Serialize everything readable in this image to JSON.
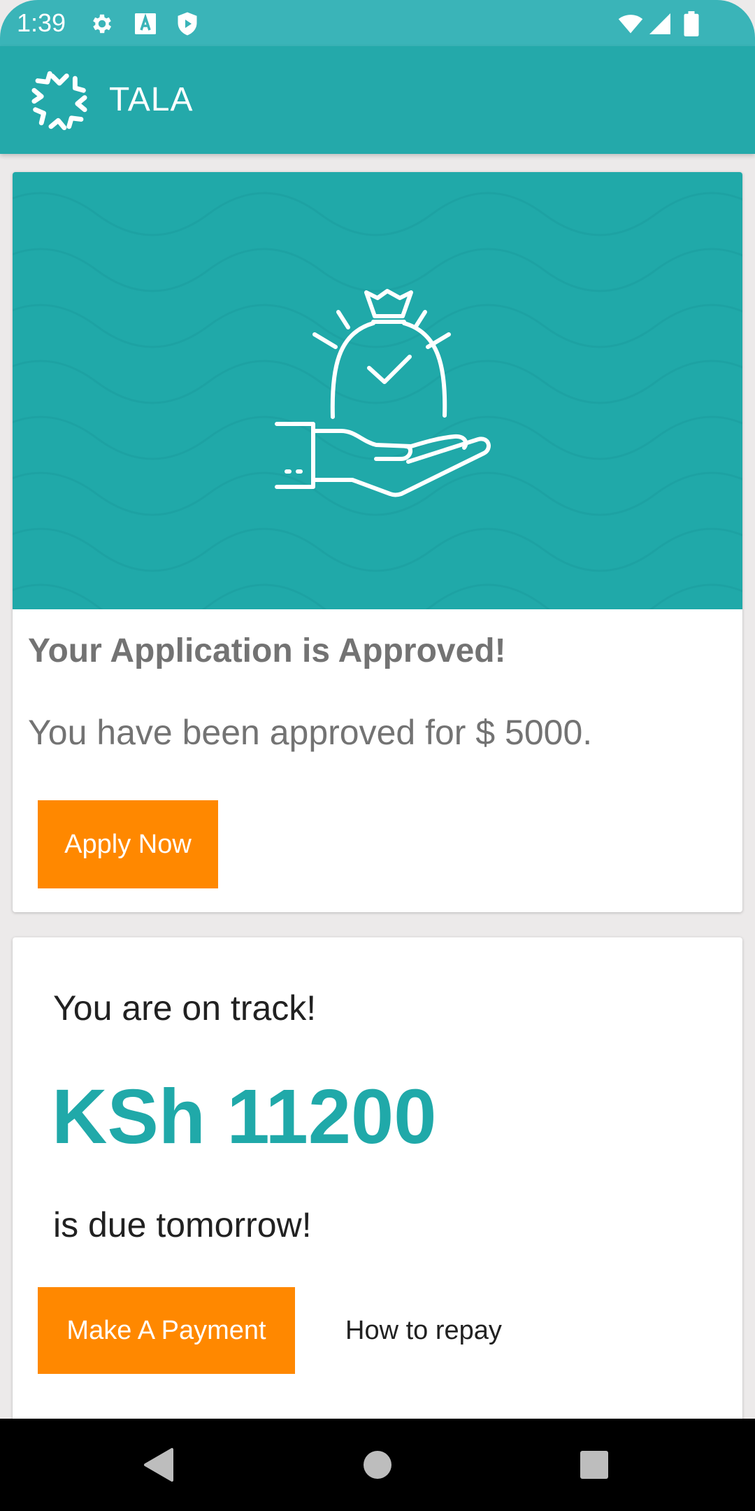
{
  "status_bar": {
    "time": "1:39",
    "icons": [
      "gear-icon",
      "font-a-icon",
      "shield-play-icon",
      "wifi-icon",
      "signal-icon",
      "battery-icon"
    ],
    "background": "#3AB4B8"
  },
  "app_bar": {
    "title": "TALA",
    "logo": "tala-burst-logo",
    "background": "#24A9AA"
  },
  "approved_card": {
    "illustration": "hand-money-bag-check-icon",
    "title": "Your Application is Approved!",
    "message": "You have been approved for $ 5000.",
    "apply_button_label": "Apply Now",
    "hero_color": "#20A9A9"
  },
  "track_card": {
    "heading": "You are on track!",
    "amount": "KSh 11200",
    "due_text": "is due tomorrow!",
    "pay_button_label": "Make A Payment",
    "repay_link_label": "How to repay",
    "amount_color": "#20A9A9"
  },
  "colors": {
    "accent": "#FF8800",
    "teal": "#20A9A9",
    "page_background": "#ECEAEA"
  },
  "nav_bar": {
    "icons": [
      "back-icon",
      "home-icon",
      "recents-icon"
    ]
  }
}
